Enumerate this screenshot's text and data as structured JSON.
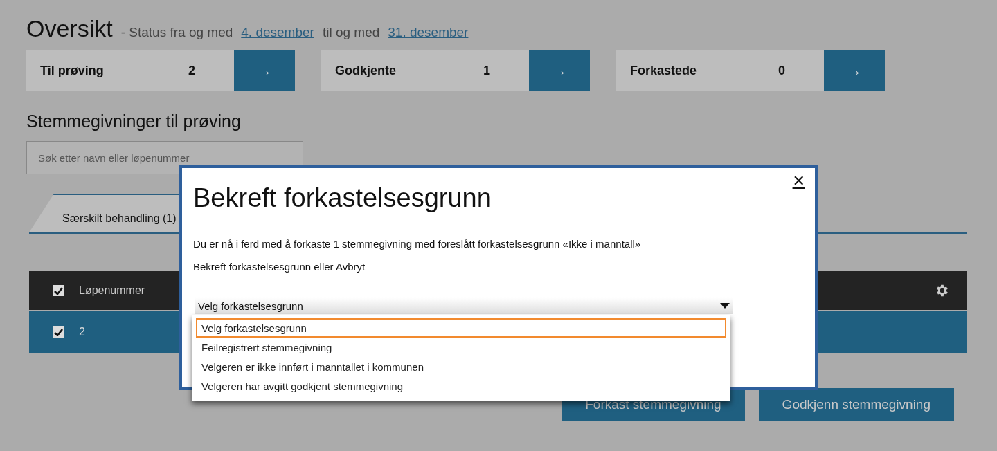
{
  "header": {
    "title": "Oversikt",
    "status_prefix": "- Status fra og med",
    "from_link": "4. desember",
    "status_middle": "til og med",
    "to_link": "31. desember"
  },
  "summary_cards": [
    {
      "label": "Til prøving",
      "count": "2",
      "arrow": "→"
    },
    {
      "label": "Godkjente",
      "count": "1",
      "arrow": "→"
    },
    {
      "label": "Forkastede",
      "count": "0",
      "arrow": "→"
    }
  ],
  "section_title": "Stemmegivninger til prøving",
  "search": {
    "placeholder": "Søk etter navn eller løpenummer"
  },
  "tabs": [
    {
      "label": "Særskilt behandling (1)",
      "selected": true
    }
  ],
  "table": {
    "header": {
      "checked": true,
      "column": "Løpenummer"
    },
    "rows": [
      {
        "checked": true,
        "selected": true,
        "value": "2"
      }
    ]
  },
  "actions": [
    "Forkast stemmegivning",
    "Godkjenn stemmegivning"
  ],
  "dialog": {
    "title": "Bekreft forkastelsesgrunn",
    "close": "✕",
    "message": "Du er nå i ferd med å forkaste 1 stemmegivning med foreslått forkastelsesgrunn «Ikke i manntall»",
    "instruction": "Bekreft forkastelsesgrunn eller Avbryt",
    "select": {
      "value": "Velg forkastelsesgrunn",
      "expanded": true,
      "options": [
        {
          "label": "Velg forkastelsesgrunn",
          "selected": true
        },
        {
          "label": "Feilregistrert stemmegivning",
          "selected": false
        },
        {
          "label": "Velgeren er ikke innført i manntallet i kommunen",
          "selected": false
        },
        {
          "label": "Velgeren har avgitt godkjent stemmegivning",
          "selected": false
        }
      ]
    }
  }
}
